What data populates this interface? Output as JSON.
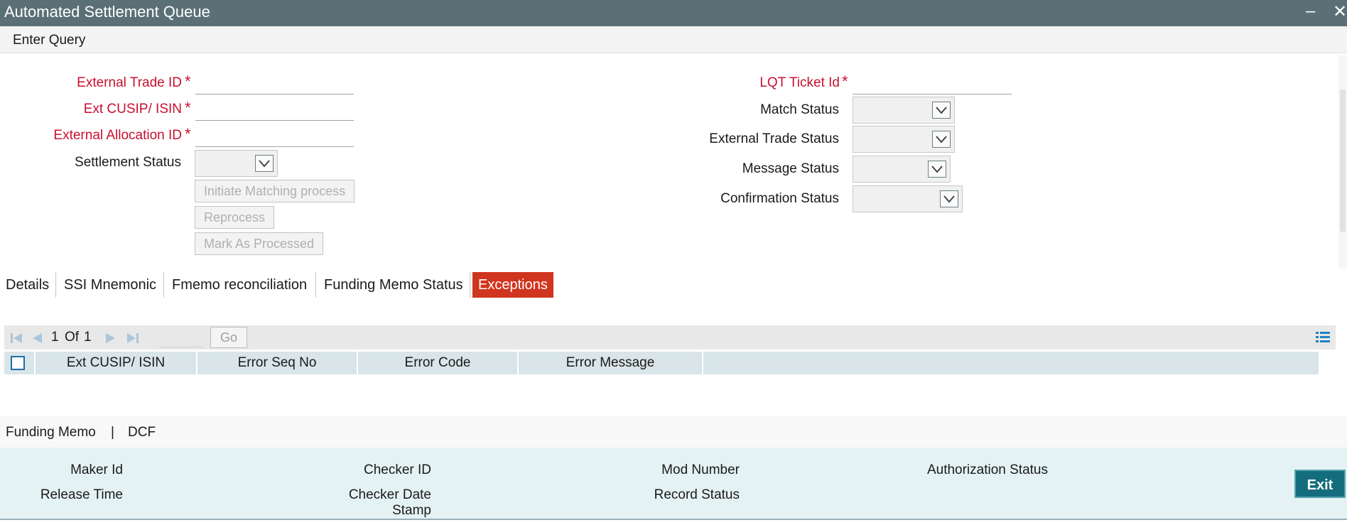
{
  "window": {
    "title": "Automated Settlement Queue",
    "minimize": "–",
    "close": "✕"
  },
  "menu": {
    "enter_query": "Enter Query"
  },
  "form": {
    "external_trade_id": {
      "label": "External Trade ID",
      "value": ""
    },
    "ext_cusip_isin": {
      "label": "Ext CUSIP/ ISIN",
      "value": ""
    },
    "external_allocation_id": {
      "label": "External Allocation ID",
      "value": ""
    },
    "settlement_status": {
      "label": "Settlement Status",
      "value": ""
    },
    "lqt_ticket_id": {
      "label": "LQT Ticket Id",
      "value": ""
    },
    "match_status": {
      "label": "Match Status",
      "value": ""
    },
    "external_trade_status": {
      "label": "External Trade Status",
      "value": ""
    },
    "message_status": {
      "label": "Message Status",
      "value": ""
    },
    "confirmation_status": {
      "label": "Confirmation Status",
      "value": ""
    },
    "required_marker": "*"
  },
  "actions": {
    "initiate_matching": "Initiate Matching process",
    "reprocess": "Reprocess",
    "mark_as_processed": "Mark As Processed"
  },
  "tabs": [
    {
      "label": "Details"
    },
    {
      "label": "SSI Mnemonic"
    },
    {
      "label": "Fmemo reconciliation"
    },
    {
      "label": "Funding Memo Status"
    },
    {
      "label": "Exceptions"
    }
  ],
  "active_tab": "Exceptions",
  "pager": {
    "current": "1",
    "of": "Of",
    "total": "1",
    "go": "Go"
  },
  "grid": {
    "columns": [
      "Ext CUSIP/ ISIN",
      "Error Seq No",
      "Error Code",
      "Error Message"
    ],
    "rows": []
  },
  "links": {
    "funding_memo": "Funding Memo",
    "separator": "|",
    "dcf": "DCF"
  },
  "audit": {
    "maker_id": "Maker Id",
    "release_time": "Release Time",
    "checker_id": "Checker ID",
    "checker_date_stamp_1": "Checker Date",
    "checker_date_stamp_2": "Stamp",
    "mod_number": "Mod Number",
    "record_status": "Record Status",
    "authorization_status": "Authorization Status"
  },
  "exit": "Exit",
  "colors": {
    "titlebar": "#5a7076",
    "required": "#c8102e",
    "active_tab": "#d0351f",
    "exit": "#136d7c"
  }
}
